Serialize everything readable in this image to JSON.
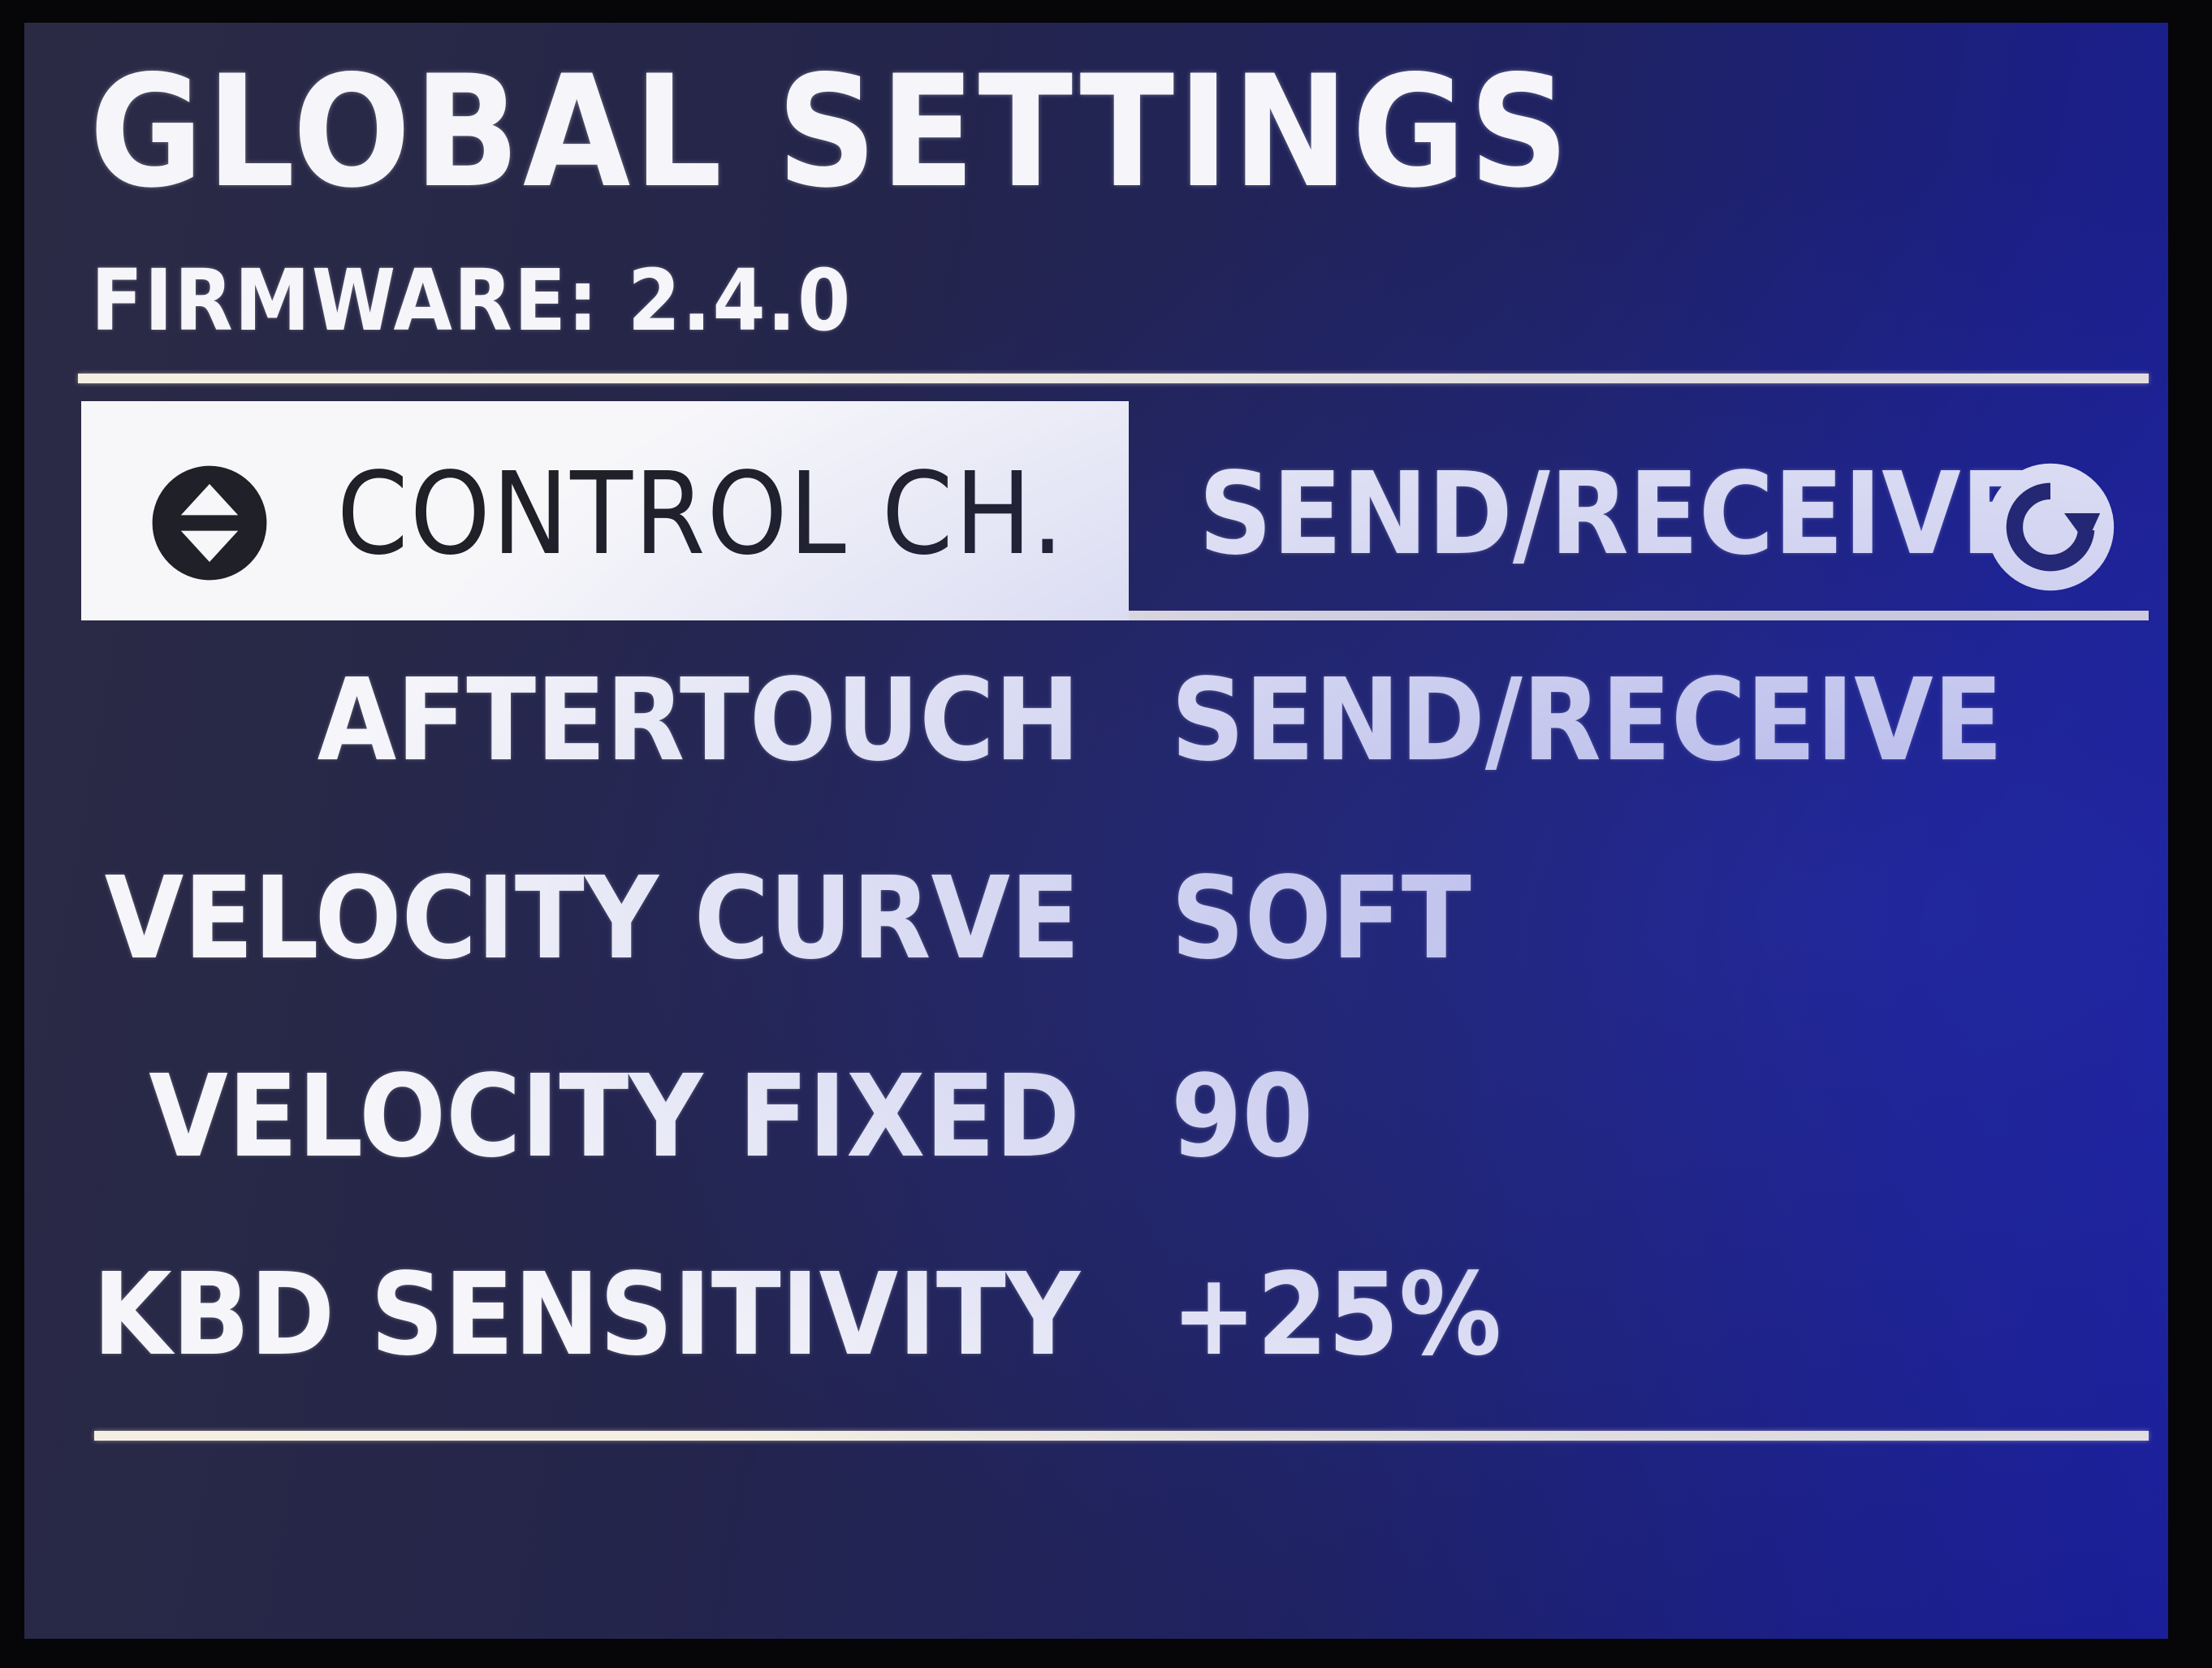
{
  "header": {
    "title": "GLOBAL SETTINGS",
    "firmware": "FIRMWARE: 2.4.0"
  },
  "selected": {
    "label": "CONTROL CH.",
    "value": "SEND/RECEIVE",
    "left_icon": "up-down-arrows-icon",
    "right_icon": "refresh-icon"
  },
  "settings": [
    {
      "label": "AFTERTOUCH",
      "value": "SEND/RECEIVE"
    },
    {
      "label": "VELOCITY CURVE",
      "value": "SOFT"
    },
    {
      "label": "VELOCITY FIXED",
      "value": "90"
    },
    {
      "label": "KBD SENSITIVITY",
      "value": "+25%"
    }
  ],
  "colors": {
    "text": "#f6f6fa",
    "highlight": "#f7f7fa",
    "highlight_text": "#202028",
    "divider": "#f4efe2",
    "background_left": "#2b2a45",
    "background_right": "#1a1e98"
  }
}
